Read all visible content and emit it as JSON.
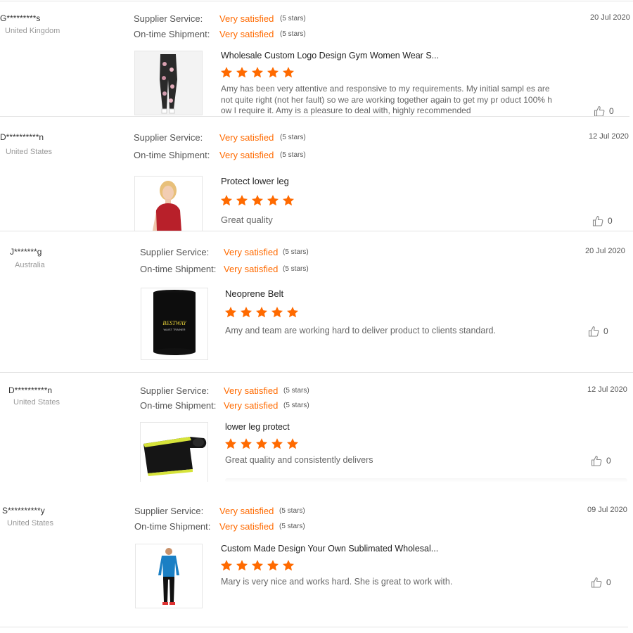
{
  "labels": {
    "supplier_service": "Supplier Service:",
    "ontime_shipment": "On-time Shipment:",
    "rating_value": "Very satisfied",
    "stars_text": "(5 stars)"
  },
  "colors": {
    "accent": "#ff6a00",
    "star": "#ff6a00"
  },
  "reviews": [
    {
      "user": "G*********s",
      "country": "United Kingdom",
      "date": "20 Jul 2020",
      "product_title": "Wholesale Custom Logo Design Gym Women Wear S...",
      "rating": 5,
      "comment": "Amy has been very attentive and responsive to my requirements.  My initial sampl es are not quite right (not her fault) so we are working together again to get my pr oduct 100% how I require it.  Amy is a pleasure to deal with, highly recommended",
      "likes": "0",
      "image": "leggings-product-photo"
    },
    {
      "user": "D**********n",
      "country": "United States",
      "date": "12 Jul 2020",
      "product_title": "Protect lower leg",
      "rating": 5,
      "comment": "Great quality",
      "likes": "0",
      "image": "woman-red-top-photo"
    },
    {
      "user": "J*******g",
      "country": "Australia",
      "date": "20 Jul 2020",
      "product_title": "Neoprene Belt",
      "rating": 5,
      "comment": "Amy and team are working hard to deliver product to clients standard.",
      "likes": "0",
      "image": "waist-trainer-belt-photo",
      "image_text": [
        "BESTWAY",
        "WAIST TRAINER"
      ]
    },
    {
      "user": "D**********n",
      "country": "United States",
      "date": "12 Jul 2020",
      "product_title": "lower leg protect",
      "rating": 5,
      "comment": "Great quality and consistently delivers",
      "likes": "0",
      "image": "leg-wrap-photo"
    },
    {
      "user": "S**********y",
      "country": "United States",
      "date": "09 Jul 2020",
      "product_title": "Custom Made Design Your Own Sublimated Wholesal...",
      "rating": 5,
      "comment": "Mary is very nice and works hard. She is great to work with.",
      "likes": "0",
      "image": "man-blue-rashguard-photo"
    }
  ]
}
